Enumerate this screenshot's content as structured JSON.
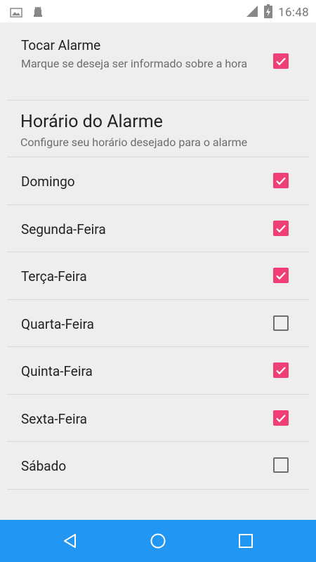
{
  "status_bar": {
    "time": "16:48"
  },
  "alarm_toggle": {
    "title": "Tocar Alarme",
    "summary": "Marque se deseja ser informado sobre a hora",
    "checked": true
  },
  "alarm_schedule": {
    "title": "Horário do Alarme",
    "summary": "Configure seu horário desejado para o alarme"
  },
  "days": [
    {
      "label": "Domingo",
      "checked": true
    },
    {
      "label": "Segunda-Feira",
      "checked": true
    },
    {
      "label": "Terça-Feira",
      "checked": true
    },
    {
      "label": "Quarta-Feira",
      "checked": false
    },
    {
      "label": "Quinta-Feira",
      "checked": true
    },
    {
      "label": "Sexta-Feira",
      "checked": true
    },
    {
      "label": "Sábado",
      "checked": false
    }
  ],
  "colors": {
    "accent": "#ef3f76",
    "nav_bar": "#2196f3",
    "background": "#eeeeee"
  },
  "nav_bar": {
    "buttons": [
      "back-icon",
      "home-icon",
      "recents-icon"
    ]
  }
}
